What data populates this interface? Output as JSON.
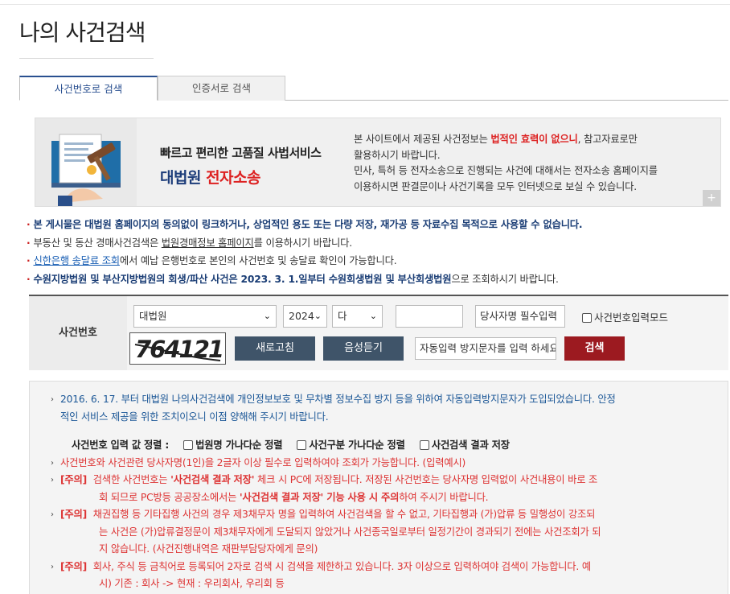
{
  "page": {
    "title": "나의 사건검색"
  },
  "tabs": [
    {
      "label": "사건번호로 검색",
      "active": true
    },
    {
      "label": "인증서로 검색",
      "active": false
    }
  ],
  "banner": {
    "tagline": "빠르고 편리한 고품질 사법서비스",
    "brand_part1": "대법원",
    "brand_part2": "전자소송",
    "notice_part1": "본 사이트에서 제공된 사건정보는 ",
    "notice_emphasis": "법적인 효력이 없으니",
    "notice_part2": ", 참고자료로만",
    "notice_line2": "활용하시기 바랍니다.",
    "notice_line3": "민사, 특허 등 전자소송으로 진행되는 사건에 대해서는 전자소송 홈페이지를",
    "notice_line4": "이용하시면 판결문이나 사건기록을 모두 인터넷으로 보실 수 있습니다.",
    "plus_label": "+"
  },
  "notices": {
    "n1": "본 게시물은 대법원 홈페이지의 동의없이 링크하거나, 상업적인 용도 또는 다량 저장, 재가공 등 자료수집 목적으로 사용할 수 없습니다.",
    "n2_pre": "부동산 및 동산 경매사건검색은 ",
    "n2_link": "법원경매정보 홈페이지",
    "n2_post": "를 이용하시기 바랍니다.",
    "n3_link": "신한은행 송달료 조회",
    "n3_post": "에서 예납 은행번호로 본인의 사건번호 및 송달료 확인이 가능합니다.",
    "n4_bold": "수원지방법원 및 부산지방법원의 회생/파산 사건은 2023. 3. 1.일부터 수원회생법원 및 부산회생법원",
    "n4_post": "으로 조회하시기 바랍니다."
  },
  "search": {
    "label": "사건번호",
    "court": "대법원",
    "year": "2024",
    "case_type": "다",
    "case_number": "",
    "party_placeholder": "당사자명 필수입력",
    "manual_entry_label": "사건번호입력모드",
    "captcha_text": "764121",
    "refresh_label": "새로고침",
    "audio_label": "음성듣기",
    "captcha_placeholder": "자동입력 방지문자를 입력 하세요",
    "search_label": "검색"
  },
  "info": {
    "intro_line1": "2016. 6. 17. 부터 대법원 나의사건검색에 개인정보보호 및 무차별 정보수집 방지 등을 위하여 자동입력방지문자가 도입되었습니다. 안정",
    "intro_line2": "적인 서비스 제공을 위한 조치이오니 이점 양해해 주시기 바랍니다.",
    "sort_label": "사건번호 입력 값 정렬 :",
    "sort_opt1": "법원명 가나다순 정렬",
    "sort_opt2": "사건구분 가나다순 정렬",
    "sort_opt3": "사건검색 결과 저장",
    "line_party": "사건번호와 사건관련 당사자명(1인)을 2글자 이상 필수로 입력하여야 조회가 가능합니다. (입력예시)",
    "tag": "[주의]",
    "w1_a": "검색한 사건번호는 ",
    "w1_b": "'사건검색 결과 저장'",
    "w1_c": " 체크 시 PC에 저장됩니다. 저장된 사건번호는 당사자명 입력없이 사건내용이 바로 조",
    "w1_d": "회 되므로 PC방등 공공장소에서는 ",
    "w1_e": "'사건검색 결과 저장' 기능 사용 시 주의",
    "w1_f": "하여 주시기 바랍니다.",
    "w2_1": "채권집행 등 기타집행 사건의 경우 제3채무자 명을 입력하여 사건검색을 할 수 없고, 기타집행과 (가)압류 등 밀행성이 강조되",
    "w2_2": "는 사건은 (가)압류결정문이 제3채무자에게 도달되지 않았거나 사건종국일로부터 일정기간이 경과되기 전에는 사건조회가 되",
    "w2_3": "지 않습니다. (사건진행내역은 재판부담당자에게 문의)",
    "w3_1": "회사, 주식 등 금칙어로 등록되어 2자로 검색 시 검색을 제한하고 있습니다. 3자 이상으로 입력하여야 검색이 가능합니다. 예",
    "w3_2": "시) 기존 : 회사 -> 현재 : 우리회사, 우리회 등"
  }
}
